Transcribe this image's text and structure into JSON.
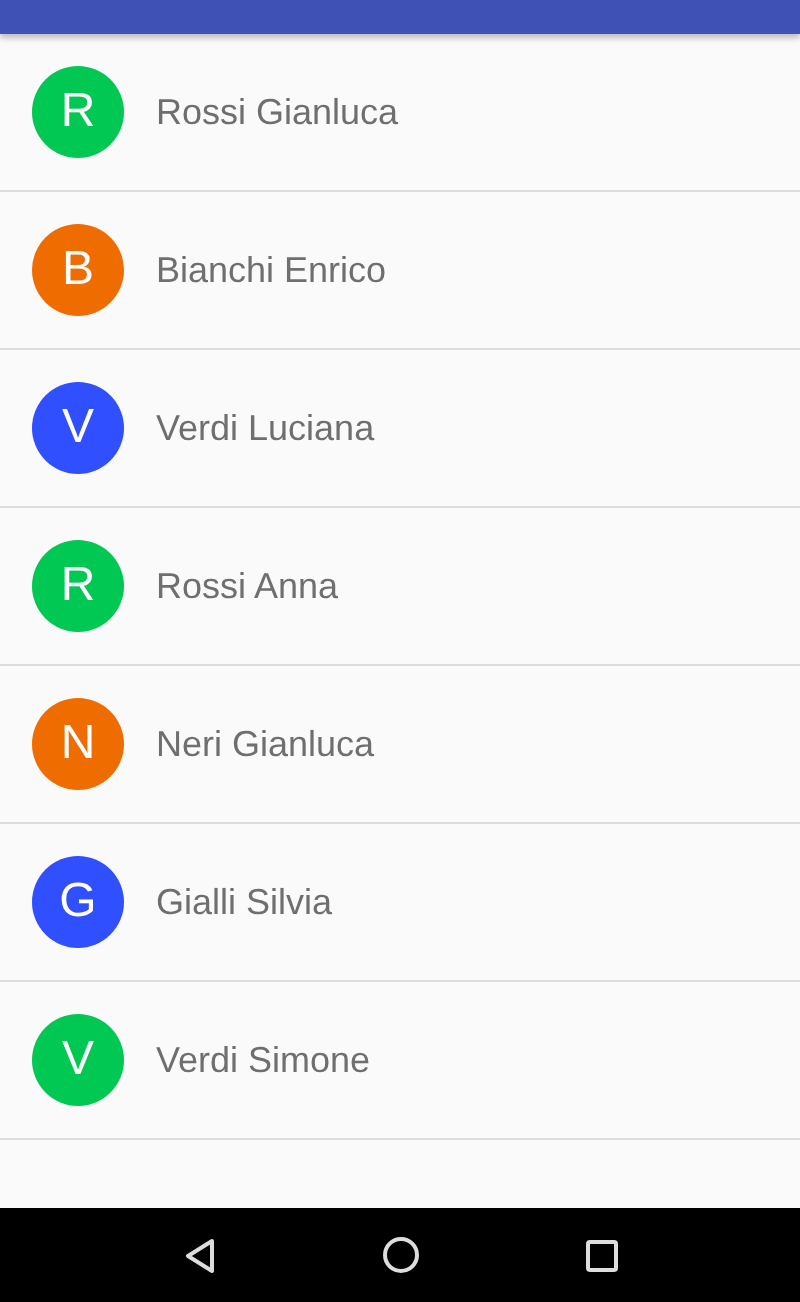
{
  "contacts": [
    {
      "initial": "R",
      "name": "Rossi Gianluca",
      "color": "#00c853"
    },
    {
      "initial": "B",
      "name": "Bianchi Enrico",
      "color": "#ef6c00"
    },
    {
      "initial": "V",
      "name": "Verdi Luciana",
      "color": "#304ffe"
    },
    {
      "initial": "R",
      "name": "Rossi Anna",
      "color": "#00c853"
    },
    {
      "initial": "N",
      "name": "Neri Gianluca",
      "color": "#ef6c00"
    },
    {
      "initial": "G",
      "name": "Gialli Silvia",
      "color": "#304ffe"
    },
    {
      "initial": "V",
      "name": "Verdi Simone",
      "color": "#00c853"
    }
  ]
}
